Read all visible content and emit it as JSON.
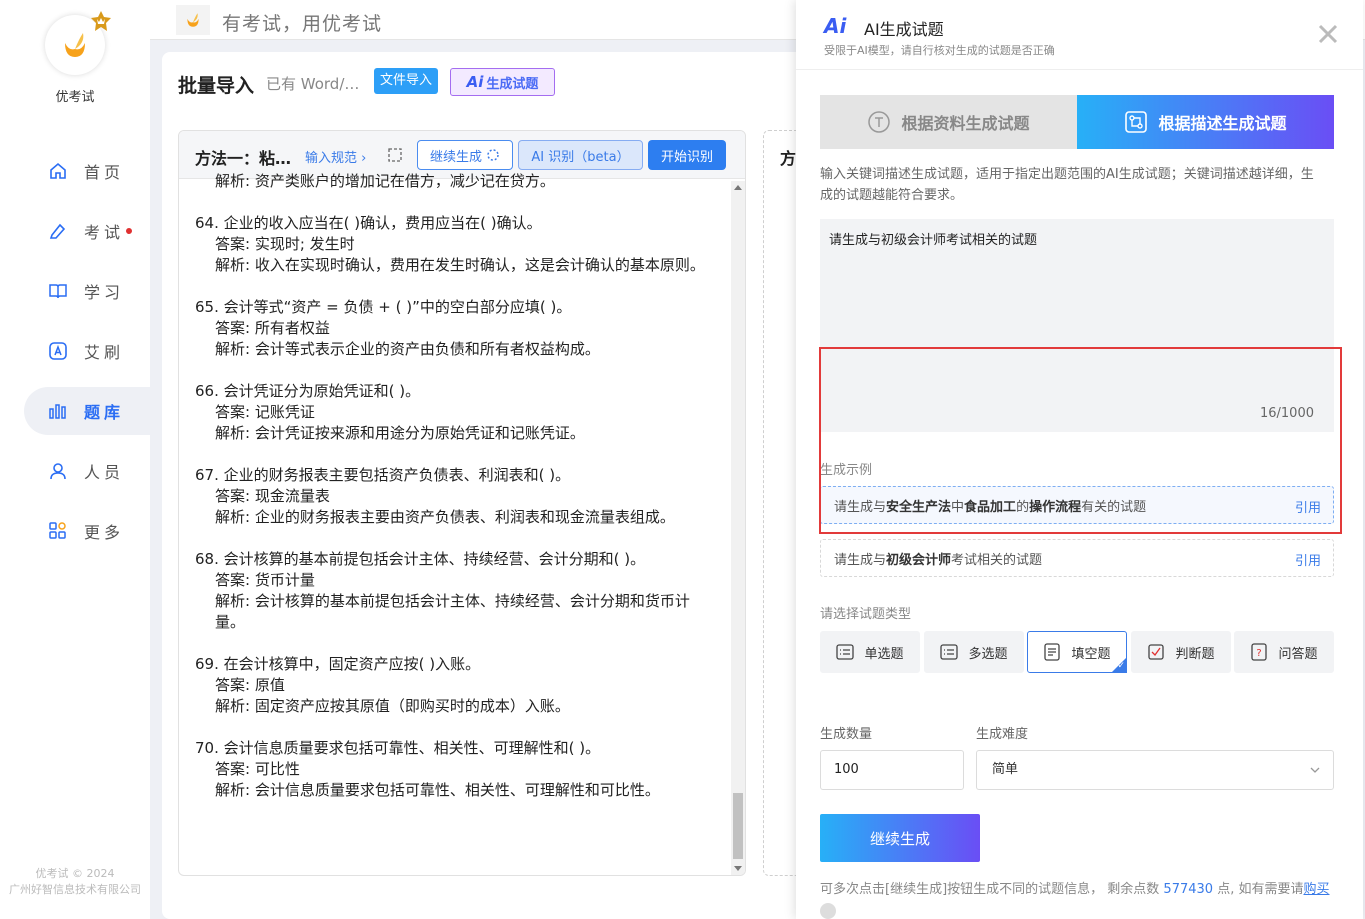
{
  "sidebar": {
    "app_name": "优考试",
    "items": [
      {
        "label": "首页",
        "icon": "home-icon"
      },
      {
        "label": "考试",
        "icon": "exam-icon"
      },
      {
        "label": "学习",
        "icon": "book-icon"
      },
      {
        "label": "艾刷",
        "icon": "ai-brush-icon"
      },
      {
        "label": "题库",
        "icon": "question-bank-icon"
      },
      {
        "label": "人员",
        "icon": "person-icon"
      },
      {
        "label": "更多",
        "icon": "more-icon"
      }
    ],
    "copyright_line1": "优考试 © 2024",
    "copyright_line2": "广州好智信息技术有限公司"
  },
  "topbar": {
    "slogan": "有考试，用优考试"
  },
  "main": {
    "title": "批量导入",
    "subtitle": "已有 Word/…",
    "file_import_label": "文件导入",
    "ai_generate_label": "生成试题",
    "method": {
      "title": "方法一：粘…",
      "rule_link": "输入规范",
      "continue_label": "继续生成",
      "ai_recognize_label": "AI 识别（beta）",
      "start_label": "开始识别",
      "partial_top_line": "解析: 资产类账户的增加记在借方，减少记在贷方。",
      "questions": [
        {
          "q": "64. 企业的收入应当在(   )确认，费用应当在(   )确认。",
          "answer": "答案: 实现时; 发生时",
          "analysis": "解析: 收入在实现时确认，费用在发生时确认，这是会计确认的基本原则。"
        },
        {
          "q": "65. 会计等式“资产 = 负债 + (   )”中的空白部分应填(   )。",
          "answer": "答案: 所有者权益",
          "analysis": "解析: 会计等式表示企业的资产由负债和所有者权益构成。"
        },
        {
          "q": "66. 会计凭证分为原始凭证和(   )。",
          "answer": "答案: 记账凭证",
          "analysis": "解析: 会计凭证按来源和用途分为原始凭证和记账凭证。"
        },
        {
          "q": "67. 企业的财务报表主要包括资产负债表、利润表和(   )。",
          "answer": "答案: 现金流量表",
          "analysis": "解析: 企业的财务报表主要由资产负债表、利润表和现金流量表组成。"
        },
        {
          "q": "68. 会计核算的基本前提包括会计主体、持续经营、会计分期和(   )。",
          "answer": "答案: 货币计量",
          "analysis": "解析: 会计核算的基本前提包括会计主体、持续经营、会计分期和货币计量。"
        },
        {
          "q": "69. 在会计核算中，固定资产应按(   )入账。",
          "answer": "答案: 原值",
          "analysis": "解析: 固定资产应按其原值（即购买时的成本）入账。"
        },
        {
          "q": "70. 会计信息质量要求包括可靠性、相关性、可理解性和(   )。",
          "answer": "答案: 可比性",
          "analysis": "解析: 会计信息质量要求包括可靠性、相关性、可理解性和可比性。"
        }
      ]
    },
    "second_method_title": "方"
  },
  "panel": {
    "logo_text": "Ai",
    "title": "AI生成试题",
    "desc": "受限于AI模型，请自行核对生成的试题是否正确",
    "mode_left": "根据资料生成试题",
    "mode_right": "根据描述生成试题",
    "intro": "输入关键词描述生成试题，适用于指定出题范围的AI生成试题；关键词描述越详细，生成的试题越能符合要求。",
    "desc_value": "请生成与初级会计师考试相关的试题",
    "char_count": "16/1000",
    "examples_label": "生成示例",
    "examples": [
      {
        "parts": [
          "请生成与",
          "安全生产法",
          "中",
          "食品加工",
          "的",
          "操作流程",
          "有关的试题"
        ],
        "cite": "引用"
      },
      {
        "parts": [
          "请生成与",
          "初级会计师",
          "考试相关的试题"
        ],
        "cite": "引用"
      }
    ],
    "type_label": "请选择试题类型",
    "types": [
      {
        "label": "单选题",
        "icon": "single-choice-icon"
      },
      {
        "label": "多选题",
        "icon": "multi-choice-icon"
      },
      {
        "label": "填空题",
        "icon": "fill-blank-icon",
        "selected": true
      },
      {
        "label": "判断题",
        "icon": "true-false-icon"
      },
      {
        "label": "问答题",
        "icon": "qa-icon"
      }
    ],
    "count_label": "生成数量",
    "count_value": "100",
    "difficulty_label": "生成难度",
    "difficulty_value": "简单",
    "generate_label": "继续生成",
    "footer_prefix": "可多次点击[继续生成]按钮生成不同的试题信息，  剩余点数 ",
    "points": "577430",
    "footer_mid": " 点, 如有需要请",
    "buy_label": "购买"
  },
  "colors": {
    "accent": "#2d7ef0",
    "gradient_start": "#27b0f7",
    "gradient_end": "#6a4ef5",
    "highlight_box": "#e23a3a"
  }
}
